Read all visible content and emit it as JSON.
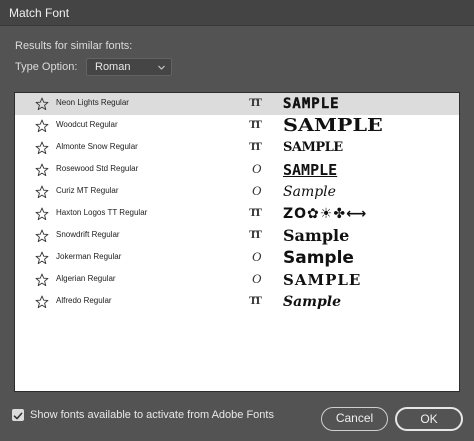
{
  "window": {
    "title": "Match Font"
  },
  "results_label": "Results for similar fonts:",
  "type_option": {
    "label": "Type Option:",
    "selected": "Roman"
  },
  "fonts": [
    {
      "name": "Neon Lights Regular",
      "format": "truetype",
      "format_glyph": "TT",
      "sample": "SAMPLE",
      "favorited": false,
      "selected": true
    },
    {
      "name": "Woodcut Regular",
      "format": "truetype",
      "format_glyph": "TT",
      "sample": "SAMPLE",
      "favorited": false,
      "selected": false
    },
    {
      "name": "Almonte Snow Regular",
      "format": "truetype",
      "format_glyph": "TT",
      "sample": "SAMPLE",
      "favorited": false,
      "selected": false
    },
    {
      "name": "Rosewood Std Regular",
      "format": "opentype",
      "format_glyph": "O",
      "sample": "SAMPLE",
      "favorited": false,
      "selected": false
    },
    {
      "name": "Curiz MT Regular",
      "format": "opentype",
      "format_glyph": "O",
      "sample": "Sample",
      "favorited": false,
      "selected": false
    },
    {
      "name": "Haxton Logos TT Regular",
      "format": "truetype",
      "format_glyph": "TT",
      "sample": "ZO✿☀✤⟷",
      "favorited": false,
      "selected": false
    },
    {
      "name": "Snowdrift Regular",
      "format": "truetype",
      "format_glyph": "TT",
      "sample": "Sample",
      "favorited": false,
      "selected": false
    },
    {
      "name": "Jokerman Regular",
      "format": "opentype",
      "format_glyph": "O",
      "sample": "Sample",
      "favorited": false,
      "selected": false
    },
    {
      "name": "Algerian Regular",
      "format": "opentype",
      "format_glyph": "O",
      "sample": "SAMPLE",
      "favorited": false,
      "selected": false
    },
    {
      "name": "Alfredo Regular",
      "format": "truetype",
      "format_glyph": "TT",
      "sample": "Sample",
      "favorited": false,
      "selected": false
    }
  ],
  "footer": {
    "show_adobe_fonts_label": "Show fonts available to activate from Adobe Fonts",
    "show_adobe_fonts_checked": true,
    "cancel_label": "Cancel",
    "ok_label": "OK"
  },
  "icons": {
    "favorite": "star-outline-icon",
    "truetype": "truetype-format-icon",
    "opentype": "opentype-format-icon",
    "dropdown": "chevron-down-icon",
    "checkbox": "checkmark-icon"
  },
  "colors": {
    "dialog_bg": "#535353",
    "titlebar_bg": "#444444",
    "list_bg": "#ffffff",
    "selected_row_bg": "#dcdcdc"
  }
}
